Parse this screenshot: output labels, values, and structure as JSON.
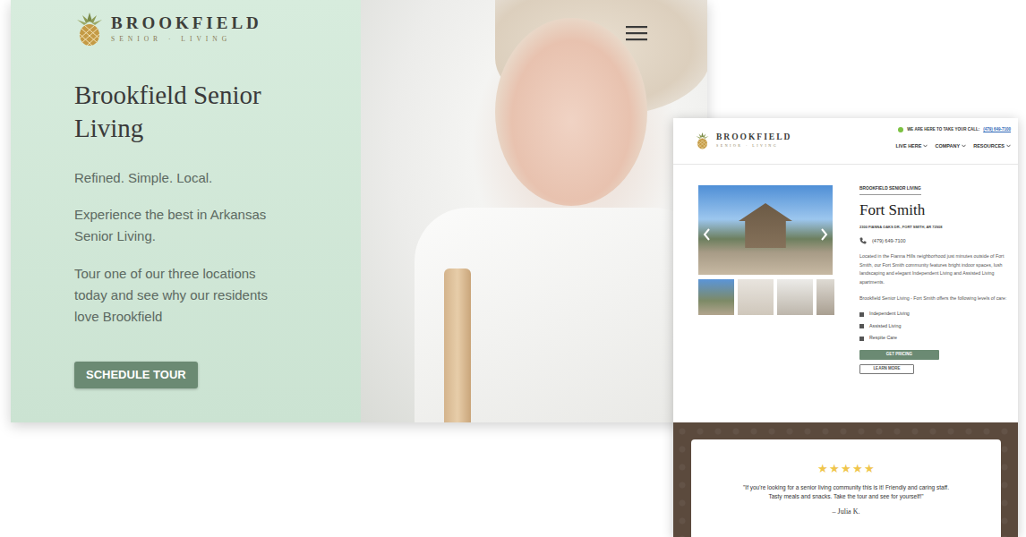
{
  "hero": {
    "logo": {
      "name": "BROOKFIELD",
      "tagline": "SENIOR · LIVING"
    },
    "title": "Brookfield Senior Living",
    "tagline": "Refined. Simple. Local.",
    "paragraphs": [
      "Experience the best in Arkansas Senior Living.",
      "Tour one of our three locations today and see why our residents love Brookfield"
    ],
    "button": "SCHEDULE TOUR"
  },
  "detail_page": {
    "topbar": {
      "online": true,
      "text": "WE ARE HERE TO TAKE YOUR CALL:",
      "phone": "(479) 649-7100"
    },
    "logo": {
      "name": "BROOKFIELD",
      "tagline": "SENIOR · LIVING"
    },
    "nav": [
      "LIVE HERE",
      "COMPANY",
      "RESOURCES"
    ],
    "community": {
      "eyebrow": "BROOKFIELD SENIOR LIVING",
      "name": "Fort Smith",
      "address": "2300 FIANNA OAKS DR., FORT SMITH, AR 72908",
      "phone": "(479) 649-7100",
      "description": "Located in the Fianna Hills neighborhood just minutes outside of Fort Smith, our Fort Smith community features bright indoor spaces, lush landscaping and elegant Independent Living and Assisted Living apartments.",
      "levels_intro": "Brookfield Senior Living - Fort Smith offers the following levels of care:",
      "levels": [
        "Independent Living",
        "Assisted Living",
        "Respite Care"
      ],
      "buttons": [
        "GET PRICING",
        "LEARN MORE"
      ]
    },
    "review": {
      "star": "★",
      "stars": 5,
      "quote": "\"If you're looking for a senior living community this is it! Friendly and caring staff. Tasty meals and snacks. Take the tour and see for yourself!\"",
      "author": "– Julia K."
    }
  }
}
